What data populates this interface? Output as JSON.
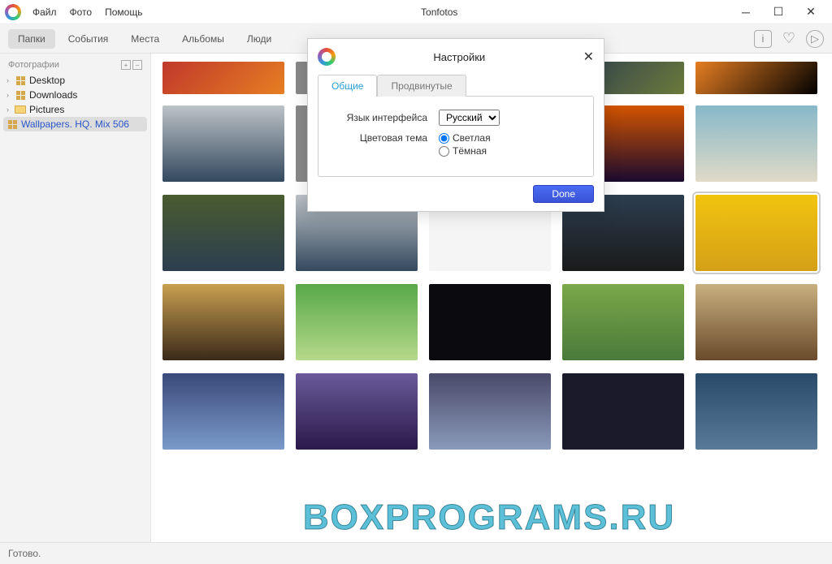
{
  "app": {
    "title": "Tonfotos"
  },
  "menu": {
    "file": "Файл",
    "photo": "Фото",
    "help": "Помощь"
  },
  "tabs": {
    "folders": "Папки",
    "events": "События",
    "places": "Места",
    "albums": "Альбомы",
    "people": "Люди"
  },
  "sidebar": {
    "header": "Фотографии",
    "items": [
      {
        "label": "Desktop",
        "icon": "grid"
      },
      {
        "label": "Downloads",
        "icon": "grid"
      },
      {
        "label": "Pictures",
        "icon": "folder"
      },
      {
        "label": "Wallpapers. HQ. Mix 506",
        "icon": "grid",
        "selected": true
      }
    ]
  },
  "settings": {
    "title": "Настройки",
    "tabs": {
      "general": "Общие",
      "advanced": "Продвинутые"
    },
    "lang_label": "Язык интерфейса",
    "lang_value": "Русский",
    "theme_label": "Цветовая тема",
    "theme_light": "Светлая",
    "theme_dark": "Тёмная",
    "done": "Done"
  },
  "status": "Готово.",
  "watermark": "BOXPROGRAMS.RU"
}
